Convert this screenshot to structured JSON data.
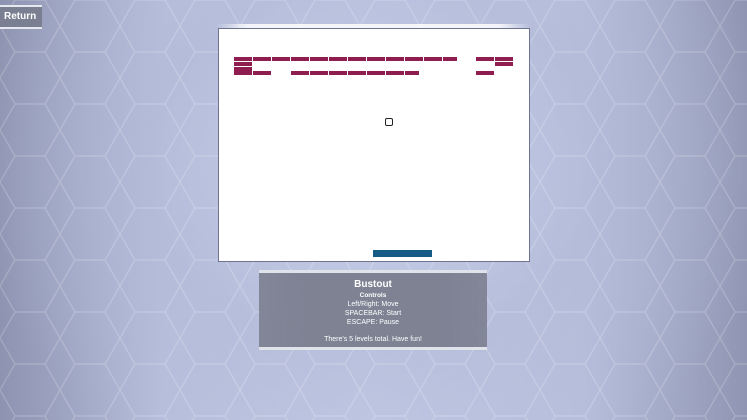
{
  "return_button": {
    "label": "Return"
  },
  "game": {
    "title": "Bustout",
    "controls_heading": "Controls",
    "controls": [
      "Left/Right: Move",
      "SPACEBAR: Start",
      "ESCAPE: Pause"
    ],
    "footer": "There's 5 levels total. Have fun!"
  },
  "colors": {
    "brick": "#8f1d4f",
    "paddle": "#155b85",
    "canvas": "#ffffff",
    "panel": "#7e8293"
  },
  "icons": {
    "ball": "ball-icon"
  }
}
